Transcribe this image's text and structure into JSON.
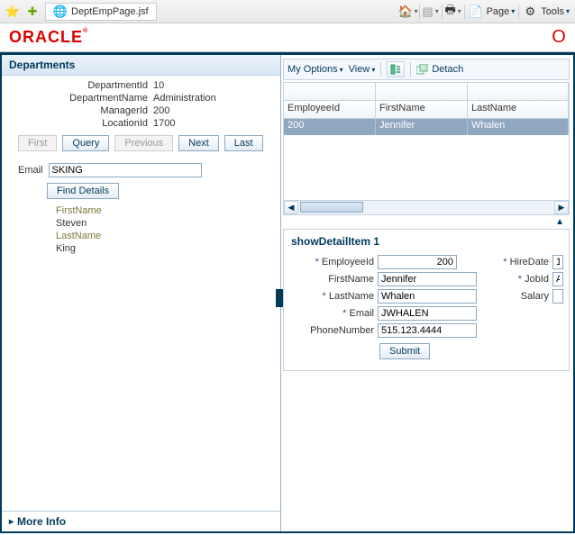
{
  "browser": {
    "tab_title": "DeptEmpPage.jsf",
    "menus": {
      "page": "Page",
      "tools": "Tools"
    }
  },
  "logo": "ORACLE",
  "departments": {
    "header": "Departments",
    "fields": {
      "dept_id_label": "DepartmentId",
      "dept_id": "10",
      "dept_name_label": "DepartmentName",
      "dept_name": "Administration",
      "manager_id_label": "ManagerId",
      "manager_id": "200",
      "location_id_label": "LocationId",
      "location_id": "1700"
    },
    "buttons": {
      "first": "First",
      "query": "Query",
      "previous": "Previous",
      "next": "Next",
      "last": "Last"
    },
    "email_label": "Email",
    "email_value": "SKING",
    "find_details": "Find Details",
    "details": {
      "firstname_label": "FirstName",
      "firstname": "Steven",
      "lastname_label": "LastName",
      "lastname": "King"
    },
    "more_info": "More Info"
  },
  "right": {
    "menus": {
      "my_options": "My Options",
      "view": "View",
      "detach": "Detach"
    },
    "table": {
      "headers": {
        "c1": "EmployeeId",
        "c2": "FirstName",
        "c3": "LastName"
      },
      "row": {
        "c1": "200",
        "c2": "Jennifer",
        "c3": "Whalen"
      }
    },
    "detail": {
      "title": "showDetailItem 1",
      "labels": {
        "emp_id": "EmployeeId",
        "hire_date": "HireDate",
        "first_name": "FirstName",
        "job_id": "JobId",
        "last_name": "LastName",
        "salary": "Salary",
        "email": "Email",
        "phone": "PhoneNumber"
      },
      "values": {
        "emp_id": "200",
        "hire_date": "1",
        "first_name": "Jennifer",
        "job_id": "A",
        "last_name": "Whalen",
        "salary": "",
        "email": "JWHALEN",
        "phone": "515.123.4444"
      },
      "submit": "Submit"
    }
  }
}
